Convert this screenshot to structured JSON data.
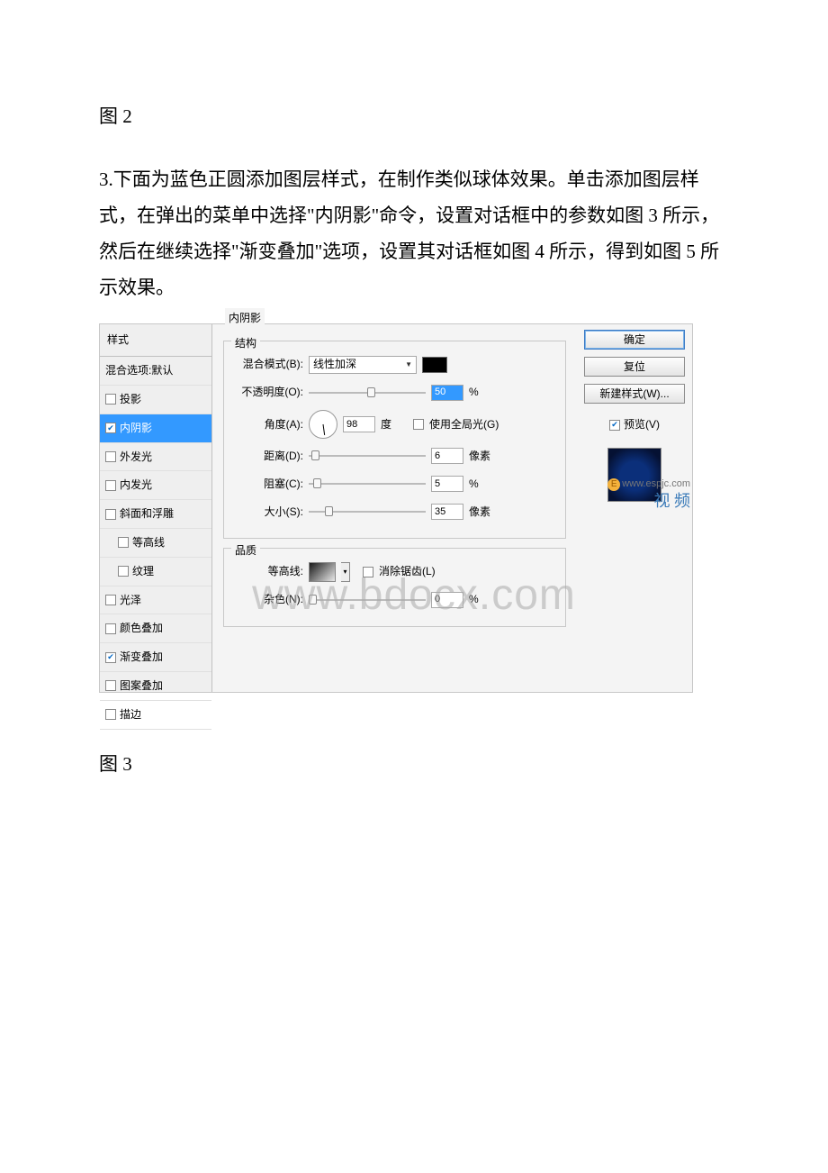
{
  "doc": {
    "fig2_label": "图 2",
    "paragraph": "3.下面为蓝色正圆添加图层样式，在制作类似球体效果。单击添加图层样式，在弹出的菜单中选择\"内阴影\"命令，设置对话框中的参数如图 3 所示，然后在继续选择\"渐变叠加\"选项，设置其对话框如图 4 所示，得到如图 5 所示效果。",
    "fig3_label": "图 3",
    "page_watermark": "www.bdocx.com"
  },
  "dialog": {
    "styles_header": "样式",
    "styles": [
      {
        "label": "混合选项:默认",
        "nocheck": true
      },
      {
        "label": "投影"
      },
      {
        "label": "内阴影",
        "checked": true,
        "selected": true
      },
      {
        "label": "外发光"
      },
      {
        "label": "内发光"
      },
      {
        "label": "斜面和浮雕"
      },
      {
        "label": "等高线",
        "indent": true
      },
      {
        "label": "纹理",
        "indent": true
      },
      {
        "label": "光泽"
      },
      {
        "label": "颜色叠加"
      },
      {
        "label": "渐变叠加",
        "checked": true
      },
      {
        "label": "图案叠加"
      },
      {
        "label": "描边"
      }
    ],
    "panel_title": "内阴影",
    "structure_legend": "结构",
    "blend_mode_label": "混合模式(B):",
    "blend_mode_value": "线性加深",
    "opacity_label": "不透明度(O):",
    "opacity_value": "50",
    "opacity_unit": "%",
    "angle_label": "角度(A):",
    "angle_value": "98",
    "angle_unit": "度",
    "global_light_label": "使用全局光(G)",
    "distance_label": "距离(D):",
    "distance_value": "6",
    "distance_unit": "像素",
    "choke_label": "阻塞(C):",
    "choke_value": "5",
    "choke_unit": "%",
    "size_label": "大小(S):",
    "size_value": "35",
    "size_unit": "像素",
    "quality_legend": "品质",
    "contour_label": "等高线:",
    "antialias_label": "消除锯齿(L)",
    "noise_label": "杂色(N):",
    "noise_value": "0",
    "noise_unit": "%",
    "buttons": {
      "ok": "确定",
      "cancel": "复位",
      "new_style": "新建样式(W)...",
      "preview": "预览(V)"
    },
    "watermark": {
      "url": "www.espjc.com",
      "brand": "视 频",
      "e": "E"
    }
  }
}
